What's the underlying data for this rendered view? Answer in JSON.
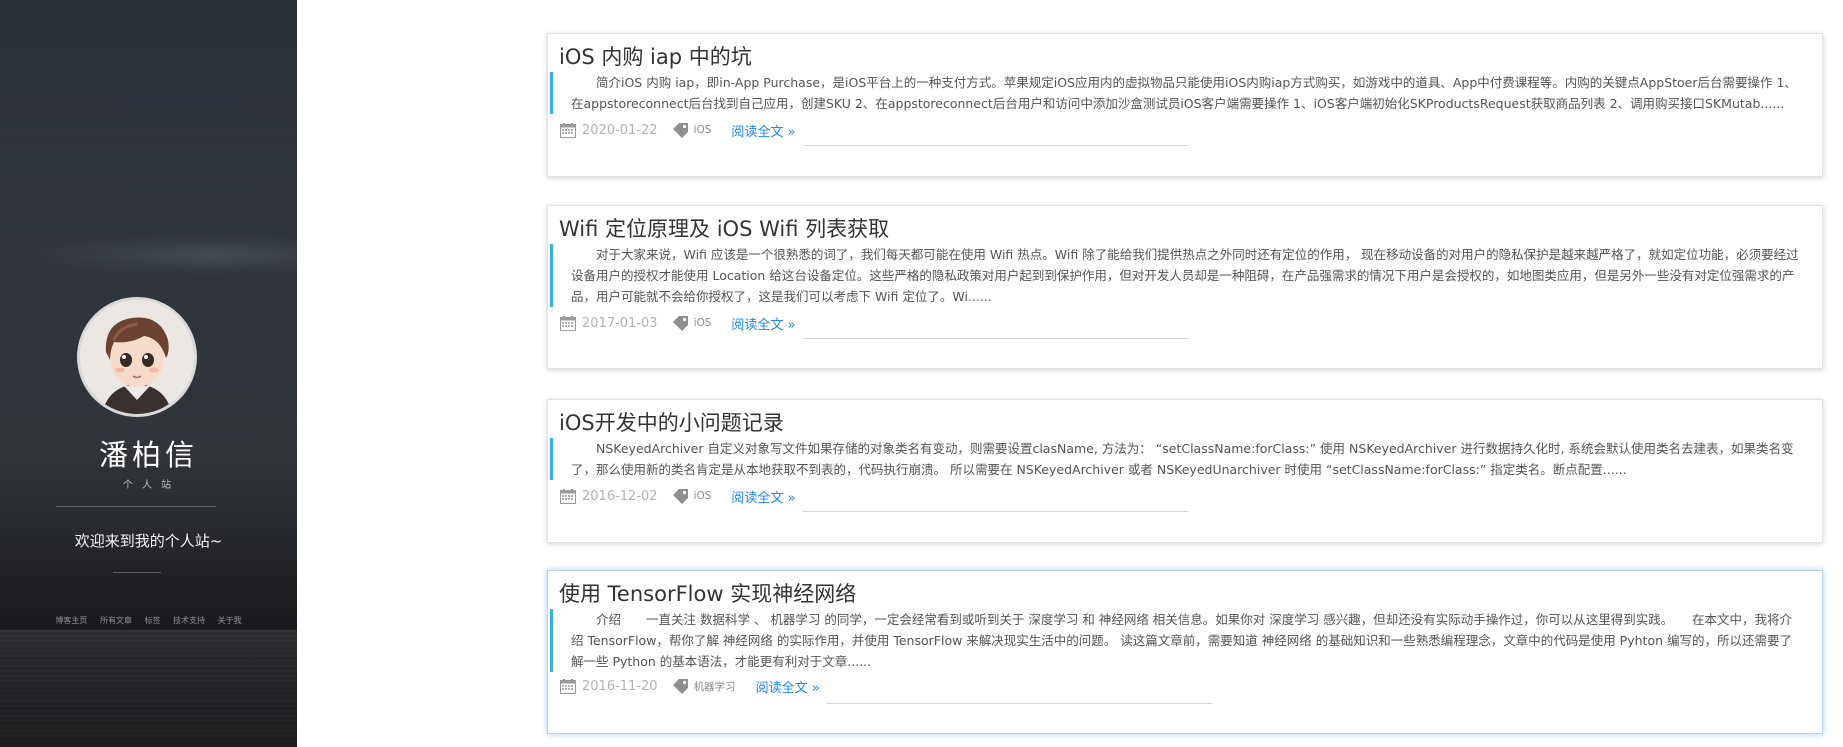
{
  "sidebar": {
    "name": "潘柏信",
    "subtitle": "个 人 站",
    "welcome": "欢迎来到我的个人站~",
    "nav": [
      "博客主页",
      "所有文章",
      "标签",
      "技术支持",
      "关于我"
    ]
  },
  "posts": [
    {
      "title": "iOS 内购 iap 中的坑",
      "excerpt": "简介iOS 内购 iap，即in-App Purchase，是iOS平台上的一种支付方式。苹果规定iOS应用内的虚拟物品只能使用iOS内购iap方式购买，如游戏中的道具、App中付费课程等。内购的关键点AppStoer后台需要操作 1、在appstoreconnect后台找到自己应用，创建SKU 2、在appstoreconnect后台用户和访问中添加沙盒测试员iOS客户端需要操作 1、iOS客户端初始化SKProductsRequest获取商品列表 2、调用购买接口SKMutab......",
      "date": "2020-01-22",
      "tag": "iOS",
      "read_more": "阅读全文 »"
    },
    {
      "title": "Wifi 定位原理及 iOS Wifi 列表获取",
      "excerpt": "对于大家来说，Wifi 应该是一个很熟悉的词了，我们每天都可能在使用 Wifi 热点。Wifi 除了能给我们提供热点之外同时还有定位的作用， 现在移动设备的对用户的隐私保护是越来越严格了，就如定位功能，必须要经过设备用户的授权才能使用 Location 给这台设备定位。这些严格的隐私政策对用户起到到保护作用，但对开发人员却是一种阻碍，在产品强需求的情况下用户是会授权的，如地图类应用，但是另外一些没有对定位强需求的产品，用户可能就不会给你授权了，这是我们可以考虑下 Wifi 定位了。Wi......",
      "date": "2017-01-03",
      "tag": "iOS",
      "read_more": "阅读全文 »"
    },
    {
      "title": "iOS开发中的小问题记录",
      "excerpt": "NSKeyedArchiver 自定义对象写文件如果存储的对象类名有变动，则需要设置clasName, 方法为： “setClassName:forClass:” 使用 NSKeyedArchiver 进行数据持久化时, 系统会默认使用类名去建表，如果类名变了，那么使用新的类名肯定是从本地获取不到表的，代码执行崩溃。 所以需要在 NSKeyedArchiver 或者 NSKeyedUnarchiver 时使用 “setClassName:forClass:” 指定类名。断点配置......",
      "date": "2016-12-02",
      "tag": "iOS",
      "read_more": "阅读全文 »"
    },
    {
      "title": "使用 TensorFlow 实现神经网络",
      "excerpt": "介绍　　一直关注 数据科学 、 机器学习 的同学，一定会经常看到或听到关于 深度学习 和 神经网络 相关信息。如果你对 深度学习 感兴趣，但却还没有实际动手操作过，你可以从这里得到实践。　　在本文中，我将介绍 TensorFlow，帮你了解 神经网络 的实际作用，并使用 TensorFlow 来解决现实生活中的问题。 读这篇文章前，需要知道 神经网络 的基础知识和一些熟悉编程理念，文章中的代码是使用 Pyhton 编写的，所以还需要了解一些 Python 的基本语法，才能更有利对于文章......",
      "date": "2016-11-20",
      "tag": "机器学习",
      "read_more": "阅读全文 »"
    }
  ]
}
